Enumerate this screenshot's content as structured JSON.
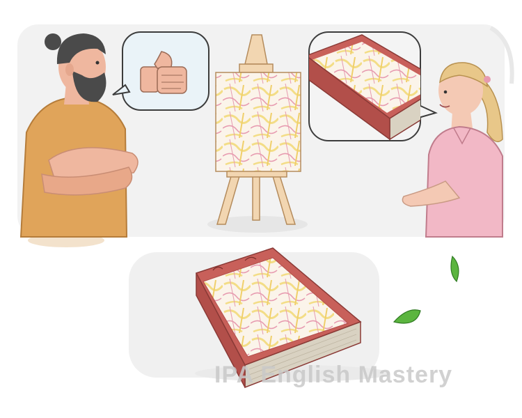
{
  "watermark": {
    "text": "IPA English Mastery"
  },
  "icons": {
    "man": "man-arms-crossed-icon",
    "thumb": "thumbs-up-icon",
    "easel": "easel-painting-icon",
    "book_bubble": "book-in-speech-bubble-icon",
    "woman": "woman-talking-icon",
    "book": "art-book-icon",
    "plant": "plant-leaf-icon"
  },
  "colors": {
    "panel_bg": "#f2f2f2",
    "man_shirt": "#e0a45a",
    "woman_shirt": "#f2b8c6",
    "book_cover": "#c8605a",
    "paint_yellow": "#f3dd86",
    "paint_pink": "#e79bb0",
    "leaf": "#5bb53f"
  }
}
